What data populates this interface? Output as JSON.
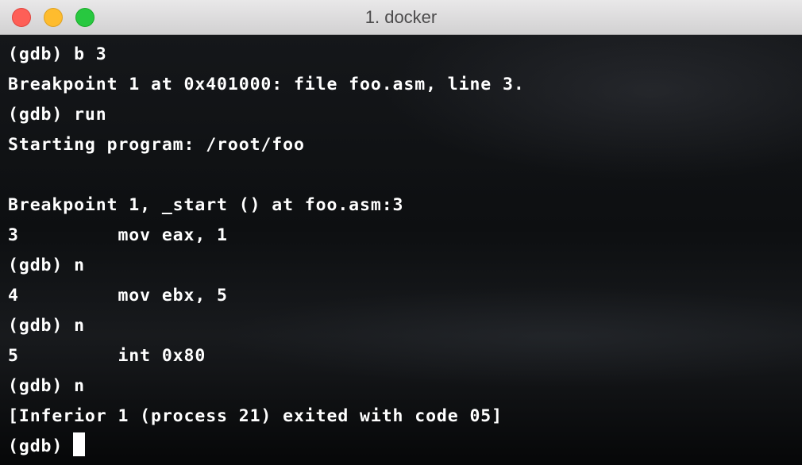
{
  "window": {
    "title": "1. docker"
  },
  "terminal": {
    "lines": [
      "(gdb) b 3",
      "Breakpoint 1 at 0x401000: file foo.asm, line 3.",
      "(gdb) run",
      "Starting program: /root/foo",
      "",
      "Breakpoint 1, _start () at foo.asm:3",
      "3         mov eax, 1",
      "(gdb) n",
      "4         mov ebx, 5",
      "(gdb) n",
      "5         int 0x80",
      "(gdb) n",
      "[Inferior 1 (process 21) exited with code 05]"
    ],
    "prompt": "(gdb)"
  },
  "colors": {
    "text": "#ffffff",
    "close": "#fe5f57",
    "minimize": "#febc2e",
    "maximize": "#28c840"
  }
}
